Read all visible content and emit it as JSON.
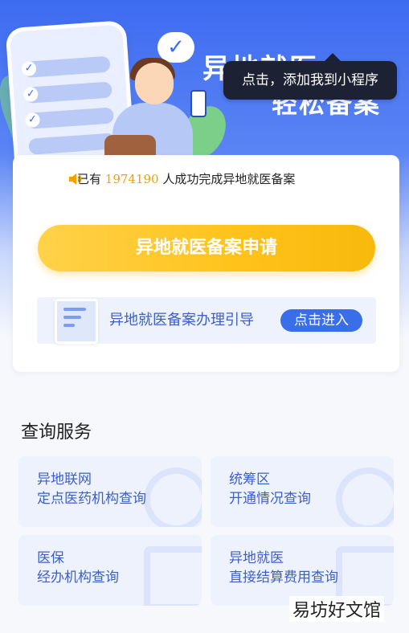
{
  "hero": {
    "title_line1": "异地就医",
    "title_line2": "轻松备案"
  },
  "tooltip": {
    "text": "点击，添加我到小程序"
  },
  "notice": {
    "prefix": "已有",
    "count": "1974190",
    "suffix": "人成功完成异地就医备案"
  },
  "apply_button": {
    "label": "异地就医备案申请"
  },
  "guide": {
    "text": "异地就医备案办理引导",
    "button_label": "点击进入"
  },
  "services": {
    "title": "查询服务",
    "items": [
      {
        "line1": "异地联网",
        "line2": "定点医药机构查询",
        "icon": "pill-icon"
      },
      {
        "line1": "统筹区",
        "line2": "开通情况查询",
        "icon": "location-pin-icon"
      },
      {
        "line1": "医保",
        "line2": "经办机构查询",
        "icon": "layers-icon"
      },
      {
        "line1": "异地就医",
        "line2": "直接结算费用查询",
        "icon": "receipt-icon"
      }
    ]
  },
  "watermark": {
    "text": "易坊好文馆"
  },
  "colors": {
    "brand_blue": "#3a6ee8",
    "accent_yellow": "#ffc21a",
    "count_orange": "#f0a100",
    "tooltip_bg": "#1c2233"
  }
}
